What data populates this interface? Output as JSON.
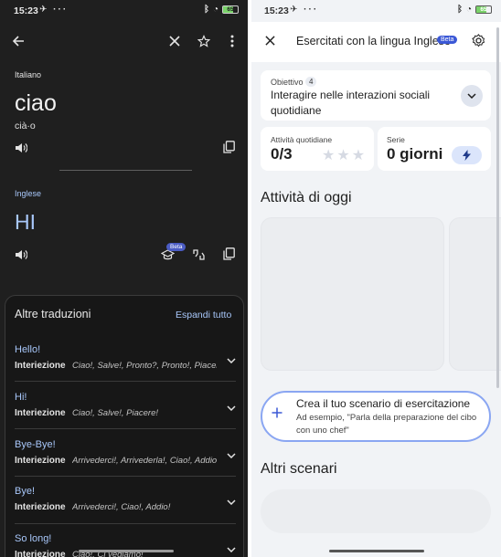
{
  "left": {
    "status": {
      "time": "15:23",
      "battery": "65"
    },
    "toolbar": {
      "back_icon": "arrow-back-icon",
      "close_icon": "close-icon",
      "star_icon": "star-outline-icon",
      "more_icon": "more-vert-icon"
    },
    "source": {
      "language": "Italiano",
      "word": "ciao",
      "phonetic": "cià·o"
    },
    "target": {
      "language": "Inglese",
      "word": "HI",
      "beta": "Beta"
    },
    "alternatives": {
      "title": "Altre traduzioni",
      "expand_all": "Espandi tutto",
      "rows": [
        {
          "word": "Hello!",
          "pos": "Interiezione",
          "synonyms": "Ciao!, Salve!, Pronto?, Pronto!, Piacere!"
        },
        {
          "word": "Hi!",
          "pos": "Interiezione",
          "synonyms": "Ciao!, Salve!, Piacere!"
        },
        {
          "word": "Bye-Bye!",
          "pos": "Interiezione",
          "synonyms": "Arrivederci!, Arrivederla!, Ciao!, Addio!"
        },
        {
          "word": "Bye!",
          "pos": "Interiezione",
          "synonyms": "Arrivederci!, Ciao!, Addio!"
        },
        {
          "word": "So long!",
          "pos": "Interiezione",
          "synonyms": "Ciao!, Ci vediamo!"
        }
      ]
    }
  },
  "right": {
    "status": {
      "time": "15:23",
      "battery": "65"
    },
    "header": {
      "title": "Esercitati con la lingua Inglese",
      "beta": "Beta"
    },
    "objective": {
      "label": "Obiettivo",
      "count": "4",
      "text": "Interagire nelle interazioni sociali quotidiane"
    },
    "daily": {
      "label": "Attività quotidiane",
      "value": "0/3",
      "stars_total": 3,
      "stars_filled": 0
    },
    "streak": {
      "label": "Serie",
      "value": "0 giorni"
    },
    "today_title": "Attività di oggi",
    "create": {
      "title": "Crea il tuo scenario di esercitazione",
      "subtitle": "Ad esempio, \"Parla della preparazione del cibo con uno chef\""
    },
    "other_title": "Altri scenari"
  },
  "colors": {
    "accent_dark": "#a8c7fa",
    "beta_badge": "#3b58d6",
    "dark_bg": "#1f1f1f",
    "light_bg": "#f1f3f6"
  }
}
